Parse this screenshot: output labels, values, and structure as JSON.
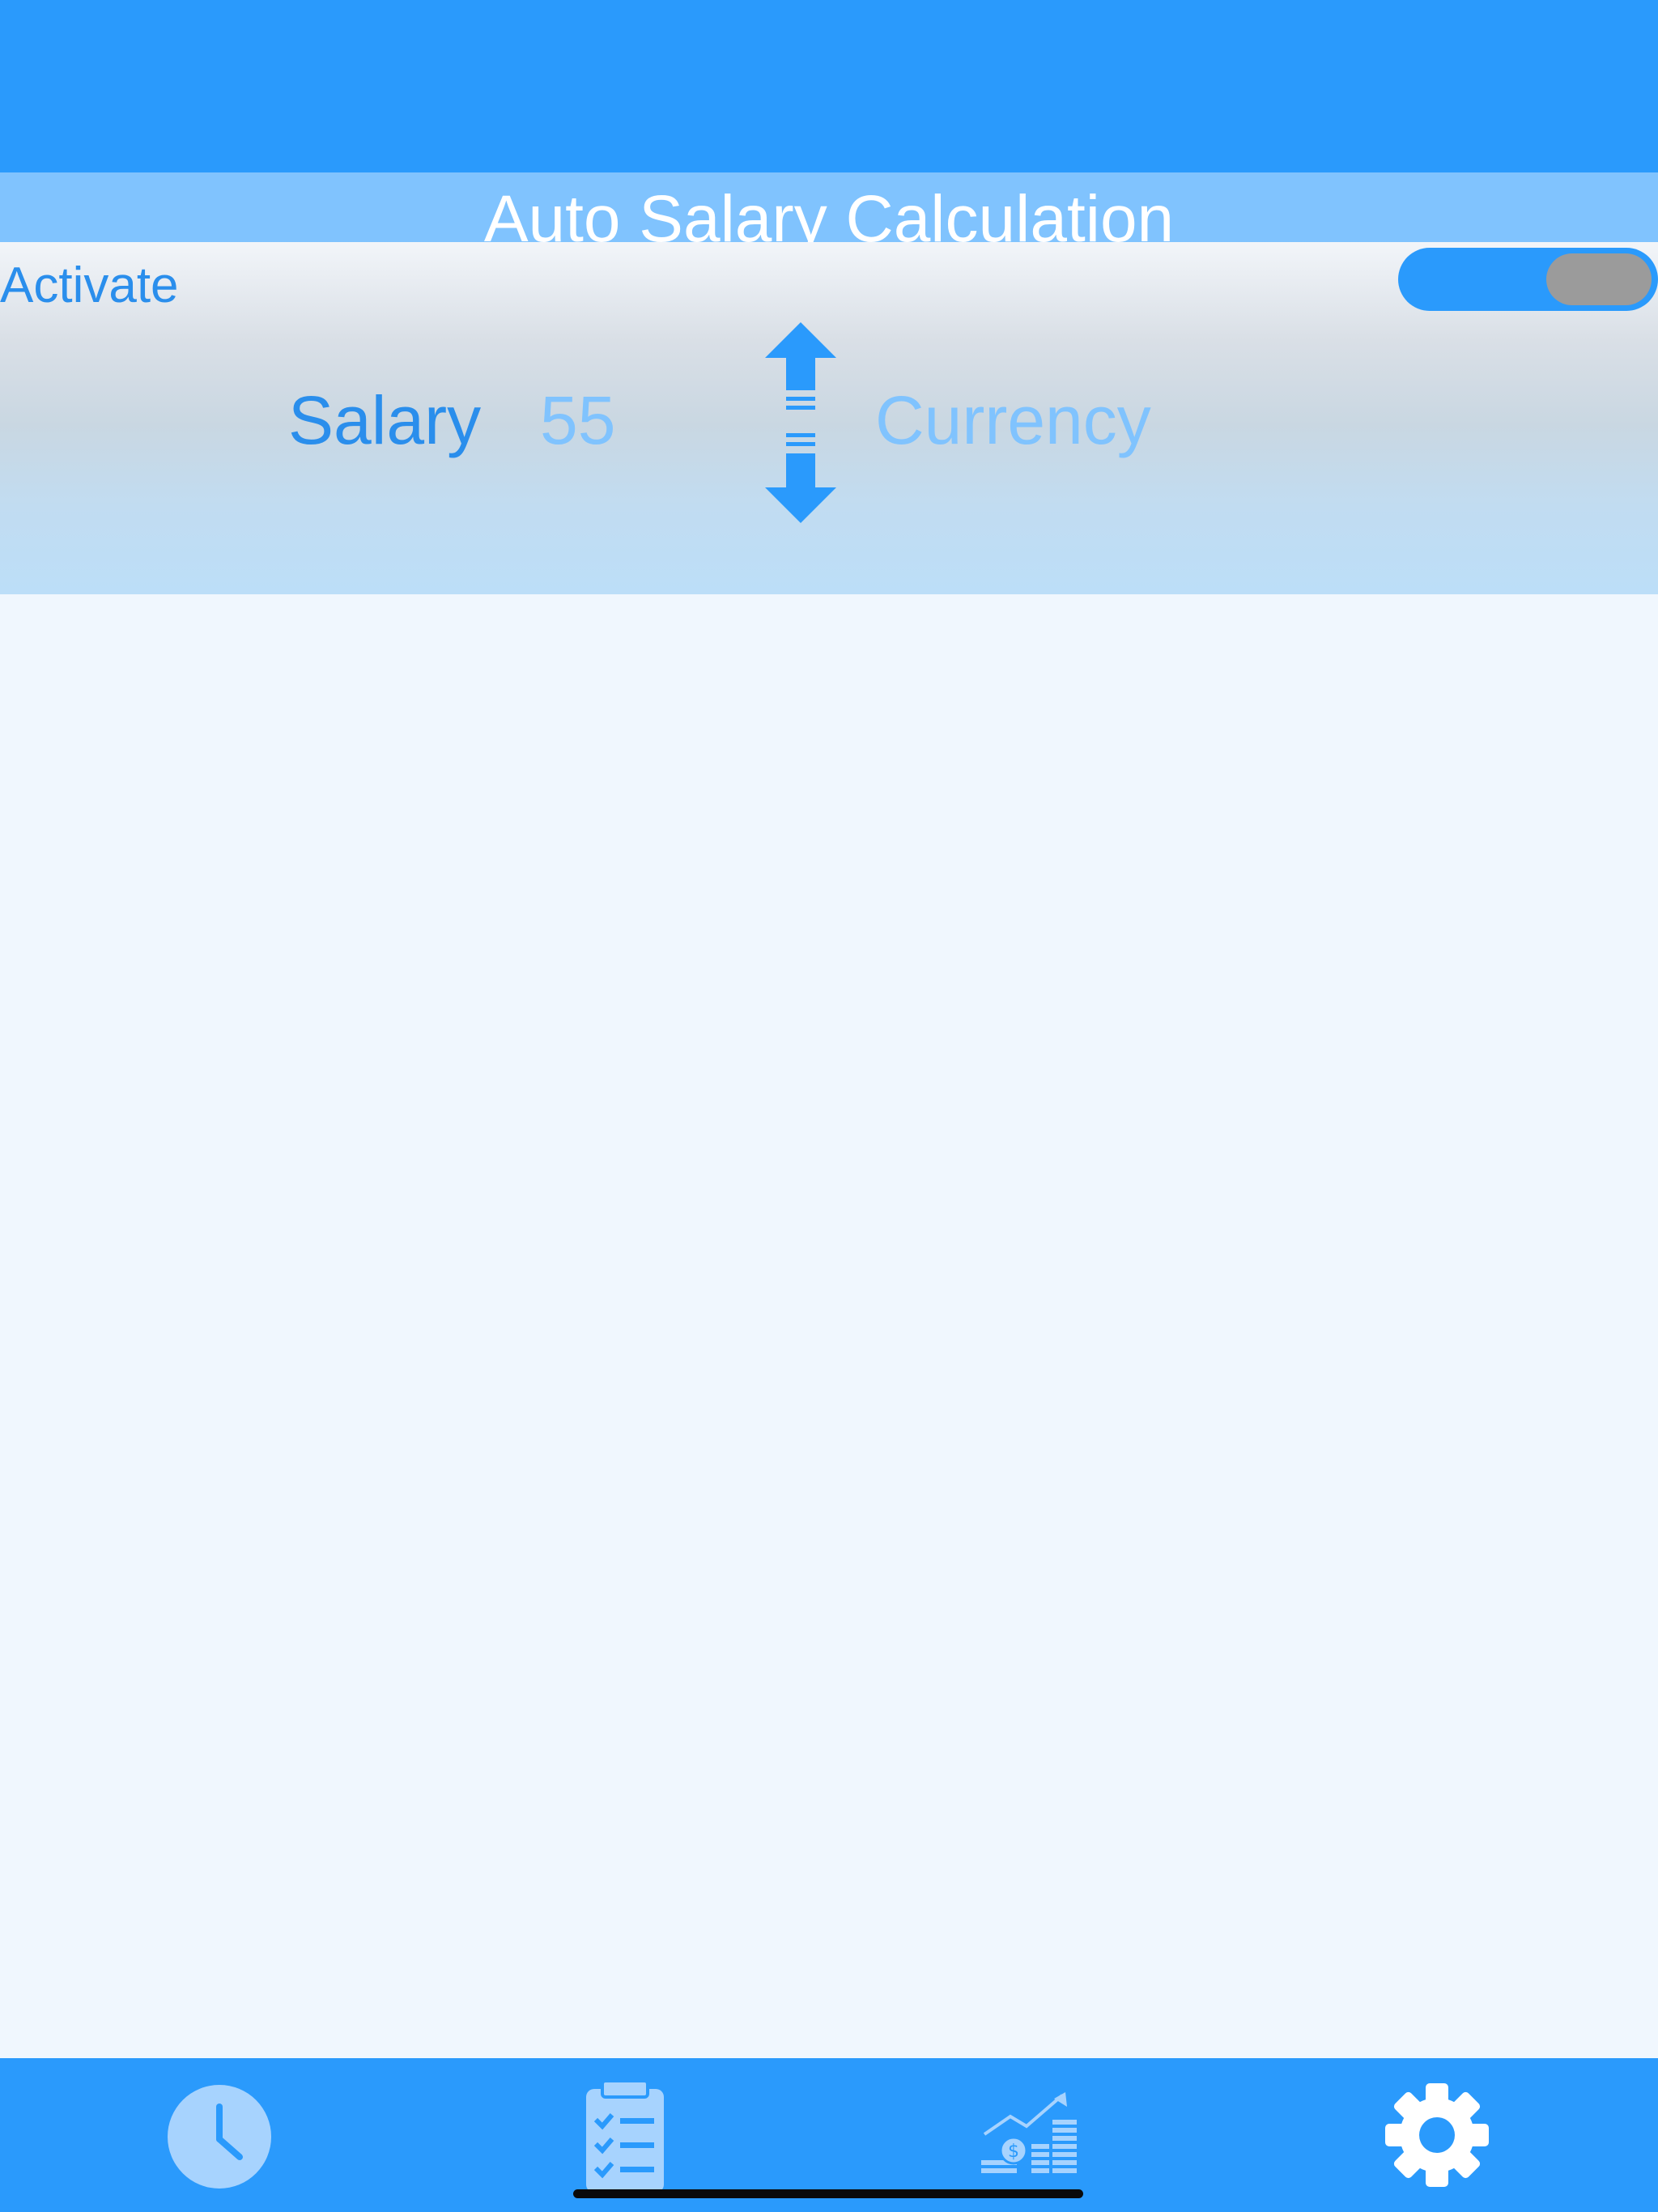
{
  "header": {
    "title": "Auto Salary Calculation"
  },
  "activation": {
    "label": "Activate",
    "toggle_on": false
  },
  "salary": {
    "label": "Salary",
    "value": "55"
  },
  "currency": {
    "label": "Currency"
  },
  "tab_bar": {
    "tabs": [
      {
        "icon": "clock-icon",
        "selected": false
      },
      {
        "icon": "checklist-clipboard-icon",
        "selected": false
      },
      {
        "icon": "money-growth-chart-icon",
        "selected": false
      },
      {
        "icon": "gear-icon",
        "selected": true
      }
    ]
  },
  "colors": {
    "primary": "#2a9afc",
    "light_accent": "#80c3fe",
    "text_blue": "#2a8eec",
    "background": "#f0f7fe",
    "toggle_knob": "#9b9b9b",
    "white": "#ffffff"
  }
}
